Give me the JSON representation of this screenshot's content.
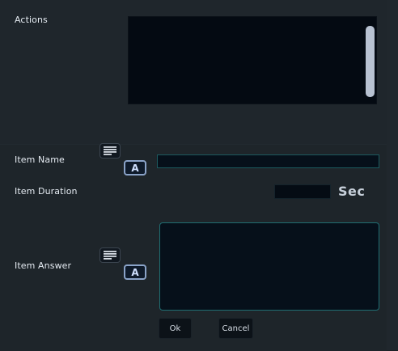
{
  "labels": {
    "actions": "Actions",
    "item_name": "Item Name",
    "item_duration": "Item Duration",
    "item_answer": "Item Answer",
    "sec": "Sec"
  },
  "icons": {
    "list": "list-icon",
    "font": "A"
  },
  "inputs": {
    "item_name_value": "",
    "item_duration_value": "",
    "item_answer_value": ""
  },
  "buttons": {
    "ok": "Ok",
    "cancel": "Cancel"
  },
  "colors": {
    "accent_border": "#1f6e72",
    "font_button_border": "#8aa3c8",
    "scroll_thumb": "#b8c2d2"
  }
}
